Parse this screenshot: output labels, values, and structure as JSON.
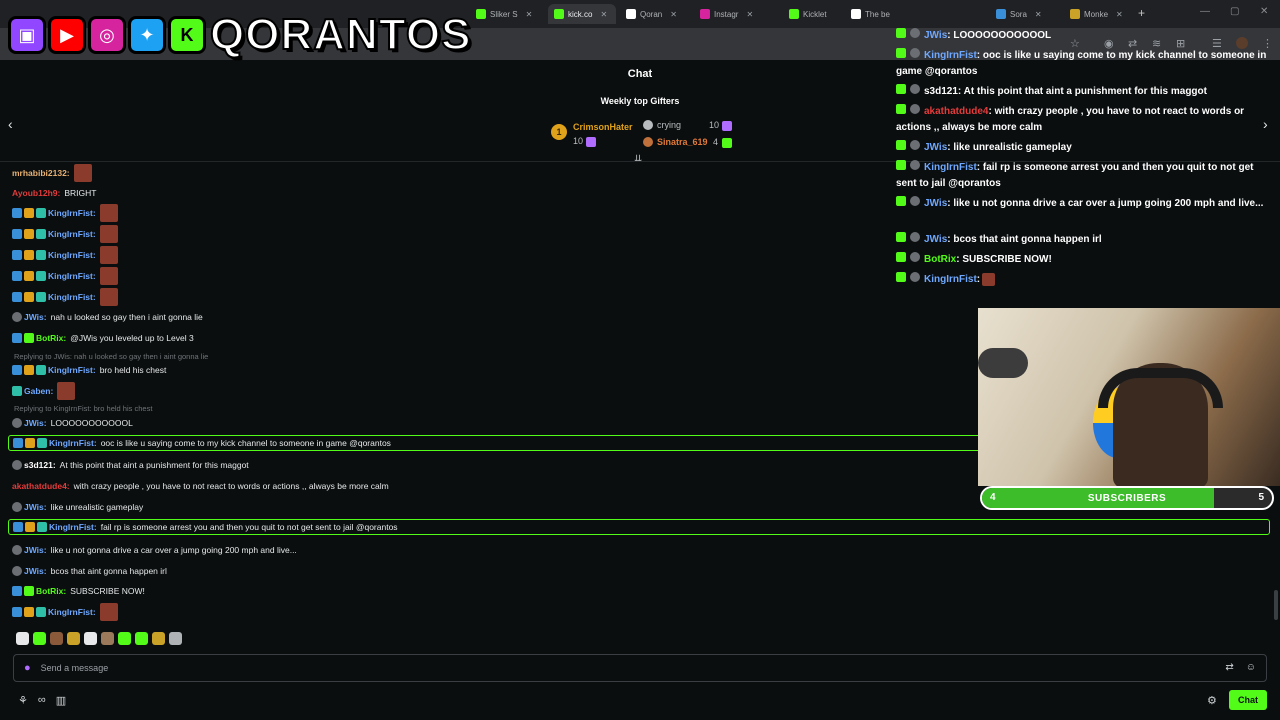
{
  "browser": {
    "tabs": [
      {
        "label": "Sliker S",
        "color": "#53fc18"
      },
      {
        "label": "kick.co",
        "color": "#53fc18",
        "active": true
      },
      {
        "label": "Qoran",
        "color": "#ffffff"
      },
      {
        "label": "Instagr",
        "color": "#d6249f"
      },
      {
        "label": "Kicklet",
        "color": "#53fc18"
      },
      {
        "label": "The be",
        "color": "#ffffff"
      },
      {
        "label": "Sora",
        "color": "#3a8fd9"
      },
      {
        "label": "Monke",
        "color": "#c9a227"
      }
    ]
  },
  "overlay_logo": {
    "text": "QORANTOS",
    "k_letter": "K"
  },
  "chat": {
    "title": "Chat",
    "weekly_title": "Weekly top Gifters",
    "gifters": [
      {
        "rank": "1",
        "name": "CrimsonHater",
        "count": "10",
        "status": "crying"
      },
      {
        "rank": "2",
        "name": "",
        "count": "10"
      },
      {
        "rank": "3",
        "name": "Sinatra_619",
        "count": "4"
      }
    ],
    "messages": [
      {
        "user": "mrhabibi2132:",
        "color": "#e8b273",
        "text": "",
        "emote": true
      },
      {
        "user": "Ayoub12h9:",
        "color": "#e33b3b",
        "text": "BRIGHT"
      },
      {
        "user": "KingIrnFist:",
        "color": "#6ea8ff",
        "text": "",
        "emote": true
      },
      {
        "user": "KingIrnFist:",
        "color": "#6ea8ff",
        "text": "",
        "emote": true
      },
      {
        "user": "KingIrnFist:",
        "color": "#6ea8ff",
        "text": "",
        "emote": true
      },
      {
        "user": "KingIrnFist:",
        "color": "#6ea8ff",
        "text": "",
        "emote": true
      },
      {
        "user": "KingIrnFist:",
        "color": "#6ea8ff",
        "text": "",
        "emote": true
      },
      {
        "user": "JWis:",
        "color": "#6ea8ff",
        "text": "nah u looked so gay then i aint gonna lie"
      },
      {
        "user": "BotRix:",
        "color": "#53fc18",
        "text": "@JWis you leveled up to Level 3"
      },
      {
        "reply": "Replying to JWis: nah u looked so gay then i aint gonna lie"
      },
      {
        "user": "KingIrnFist:",
        "color": "#6ea8ff",
        "text": "bro held his chest"
      },
      {
        "user": "Gaben:",
        "color": "#6ea8ff",
        "text": "",
        "emote": true
      },
      {
        "reply": "Replying to KingIrnFist: bro held his chest"
      },
      {
        "user": "JWis:",
        "color": "#6ea8ff",
        "text": "LOOOOOOOOOOOL"
      },
      {
        "user": "KingIrnFist:",
        "color": "#6ea8ff",
        "text": "ooc is like u saying come to my kick channel to someone in game @qorantos",
        "highlight": true
      },
      {
        "user": "s3d121:",
        "color": "#ffffff",
        "text": "At this point that aint a punishment for this maggot"
      },
      {
        "user": "akathatdude4:",
        "color": "#e33b3b",
        "text": "with crazy people , you have to not react to words or actions ,, always be more calm"
      },
      {
        "user": "JWis:",
        "color": "#6ea8ff",
        "text": "like unrealistic gameplay"
      },
      {
        "user": "KingIrnFist:",
        "color": "#6ea8ff",
        "text": "fail rp is someone arrest you and then you quit to not get sent to jail @qorantos",
        "highlight": true
      },
      {
        "user": "JWis:",
        "color": "#6ea8ff",
        "text": "like u not gonna drive a car over a jump going 200 mph and live..."
      },
      {
        "user": "JWis:",
        "color": "#6ea8ff",
        "text": "bcos that aint gonna happen irl"
      },
      {
        "user": "BotRix:",
        "color": "#53fc18",
        "text": "SUBSCRIBE NOW!"
      },
      {
        "user": "KingIrnFist:",
        "color": "#6ea8ff",
        "text": "",
        "emote": true
      }
    ],
    "input_placeholder": "Send a message",
    "chat_button": "Chat"
  },
  "overlay_chat": [
    {
      "user": "JWis",
      "text": ": LOOOOOOOOOOOL",
      "color": "#6ea8ff"
    },
    {
      "user": "KingIrnFist",
      "text": ": ooc is like u saying come to my kick channel to someone in game @qorantos",
      "color": "#6ea8ff"
    },
    {
      "user": "s3d121",
      "text": ": At this point that aint a punishment for this maggot",
      "color": "#ffffff"
    },
    {
      "user": "akathatdude4",
      "text": ": with crazy people , you have to not react to words or actions ,, always be more calm",
      "color": "#e33b3b"
    },
    {
      "user": "JWis",
      "text": ": like unrealistic gameplay",
      "color": "#6ea8ff"
    },
    {
      "user": "KingIrnFist",
      "text": ": fail rp is someone arrest you and then you quit to not get sent to jail @qorantos",
      "color": "#6ea8ff"
    },
    {
      "user": "JWis",
      "text": ": like u not gonna drive a car over a jump going 200 mph and live...",
      "color": "#6ea8ff"
    },
    {
      "user": "JWis",
      "text": ": bcos that aint gonna happen irl",
      "color": "#6ea8ff"
    },
    {
      "user": "BotRix",
      "text": ": SUBSCRIBE NOW!",
      "color": "#53fc18"
    },
    {
      "user": "KingIrnFist",
      "text": ":",
      "color": "#6ea8ff"
    }
  ],
  "sub_goal": {
    "label": "SUBSCRIBERS",
    "current": "4",
    "goal": "5",
    "progress": 0.8
  },
  "colors": {
    "kick_green": "#53fc18",
    "background": "#0b0e0f"
  }
}
